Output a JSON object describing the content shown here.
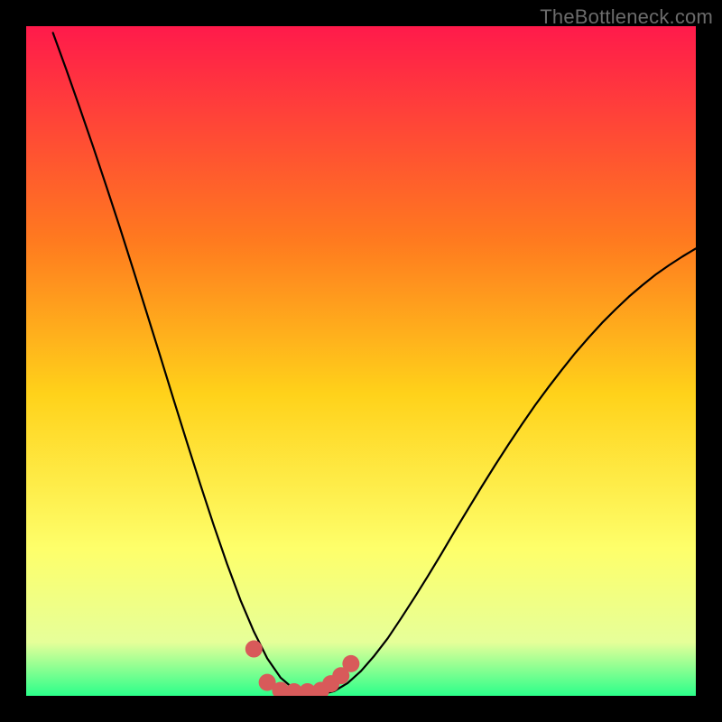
{
  "watermark": "TheBottleneck.com",
  "colors": {
    "frame": "#000000",
    "gradient_top": "#ff1a4b",
    "gradient_mid1": "#ff7a1f",
    "gradient_mid2": "#ffd21a",
    "gradient_mid3": "#feff6a",
    "gradient_mid4": "#e6ff99",
    "gradient_bottom": "#2bff8a",
    "curve": "#000000",
    "marker_fill": "#d85a5a",
    "watermark": "#6b6b6b"
  },
  "chart_data": {
    "type": "line",
    "title": "",
    "xlabel": "",
    "ylabel": "",
    "xlim": [
      0,
      100
    ],
    "ylim": [
      0,
      100
    ],
    "series": [
      {
        "name": "bottleneck-curve",
        "x": [
          4,
          6,
          8,
          10,
          12,
          14,
          16,
          18,
          20,
          22,
          24,
          26,
          28,
          30,
          32,
          34,
          36,
          38,
          40,
          42,
          44,
          46,
          48,
          50,
          52,
          54,
          56,
          58,
          60,
          62,
          64,
          66,
          68,
          70,
          72,
          74,
          76,
          78,
          80,
          82,
          84,
          86,
          88,
          90,
          92,
          94,
          96,
          98,
          100
        ],
        "y": [
          99.0,
          93.5,
          87.8,
          82.0,
          76.0,
          69.9,
          63.6,
          57.2,
          50.8,
          44.3,
          37.9,
          31.6,
          25.5,
          19.7,
          14.3,
          9.6,
          5.6,
          2.7,
          1.0,
          0.3,
          0.2,
          0.7,
          1.9,
          3.7,
          6.0,
          8.6,
          11.6,
          14.7,
          17.9,
          21.2,
          24.6,
          27.9,
          31.2,
          34.4,
          37.5,
          40.5,
          43.4,
          46.1,
          48.7,
          51.2,
          53.5,
          55.7,
          57.7,
          59.6,
          61.3,
          62.9,
          64.3,
          65.6,
          66.8
        ]
      }
    ],
    "markers": [
      {
        "name": "trough-marker-1",
        "x": 34.0,
        "y": 7.0
      },
      {
        "name": "trough-marker-2",
        "x": 36.0,
        "y": 2.0
      },
      {
        "name": "trough-marker-3",
        "x": 38.0,
        "y": 0.8
      },
      {
        "name": "trough-marker-4",
        "x": 40.0,
        "y": 0.6
      },
      {
        "name": "trough-marker-5",
        "x": 42.0,
        "y": 0.6
      },
      {
        "name": "trough-marker-6",
        "x": 44.0,
        "y": 0.8
      },
      {
        "name": "trough-marker-7",
        "x": 45.5,
        "y": 1.8
      },
      {
        "name": "trough-marker-8",
        "x": 47.0,
        "y": 3.0
      },
      {
        "name": "trough-marker-9",
        "x": 48.5,
        "y": 4.8
      }
    ]
  }
}
